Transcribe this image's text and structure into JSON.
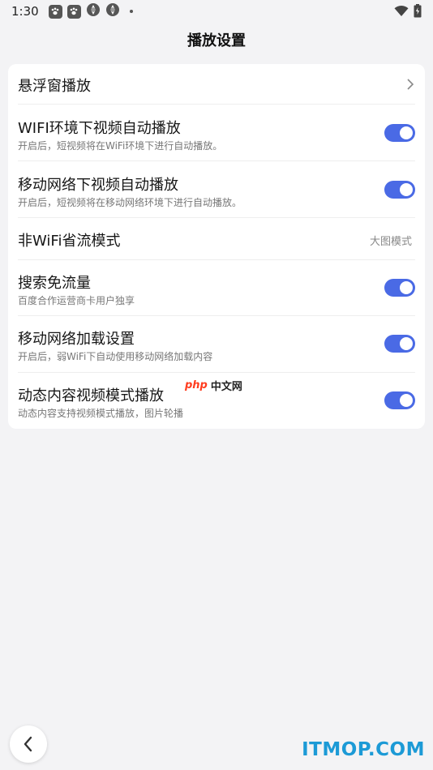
{
  "status_bar": {
    "time": "1:30",
    "icons": [
      "baidu-paw-icon",
      "baidu-paw-icon",
      "network-icon",
      "network-icon",
      "dot"
    ],
    "right_icons": [
      "wifi-icon",
      "battery-icon"
    ]
  },
  "header": {
    "title": "播放设置"
  },
  "settings": {
    "floating_window": {
      "title": "悬浮窗播放"
    },
    "wifi_autoplay": {
      "title": "WIFI环境下视频自动播放",
      "subtitle": "开启后，短视频将在WiFi环境下进行自动播放。",
      "enabled": true
    },
    "mobile_autoplay": {
      "title": "移动网络下视频自动播放",
      "subtitle": "开启后，短视频将在移动网络环境下进行自动播放。",
      "enabled": true
    },
    "non_wifi_saving": {
      "title": "非WiFi省流模式",
      "value": "大图模式"
    },
    "search_free_data": {
      "title": "搜索免流量",
      "subtitle": "百度合作运营商卡用户独享",
      "enabled": true
    },
    "mobile_loading": {
      "title": "移动网络加载设置",
      "subtitle": "开启后，弱WiFi下自动使用移动网络加载内容",
      "enabled": true
    },
    "dynamic_video_mode": {
      "title": "动态内容视频模式播放",
      "subtitle": "动态内容支持视频模式播放，图片轮播",
      "enabled": true
    }
  },
  "watermarks": {
    "php_logo": "php",
    "php_cn": "中文网",
    "itmop": "ITMOP.COM"
  },
  "colors": {
    "toggle_on": "#4a6ae5",
    "background": "#f3f3f5",
    "itmop_blue": "#1c9ad6"
  }
}
